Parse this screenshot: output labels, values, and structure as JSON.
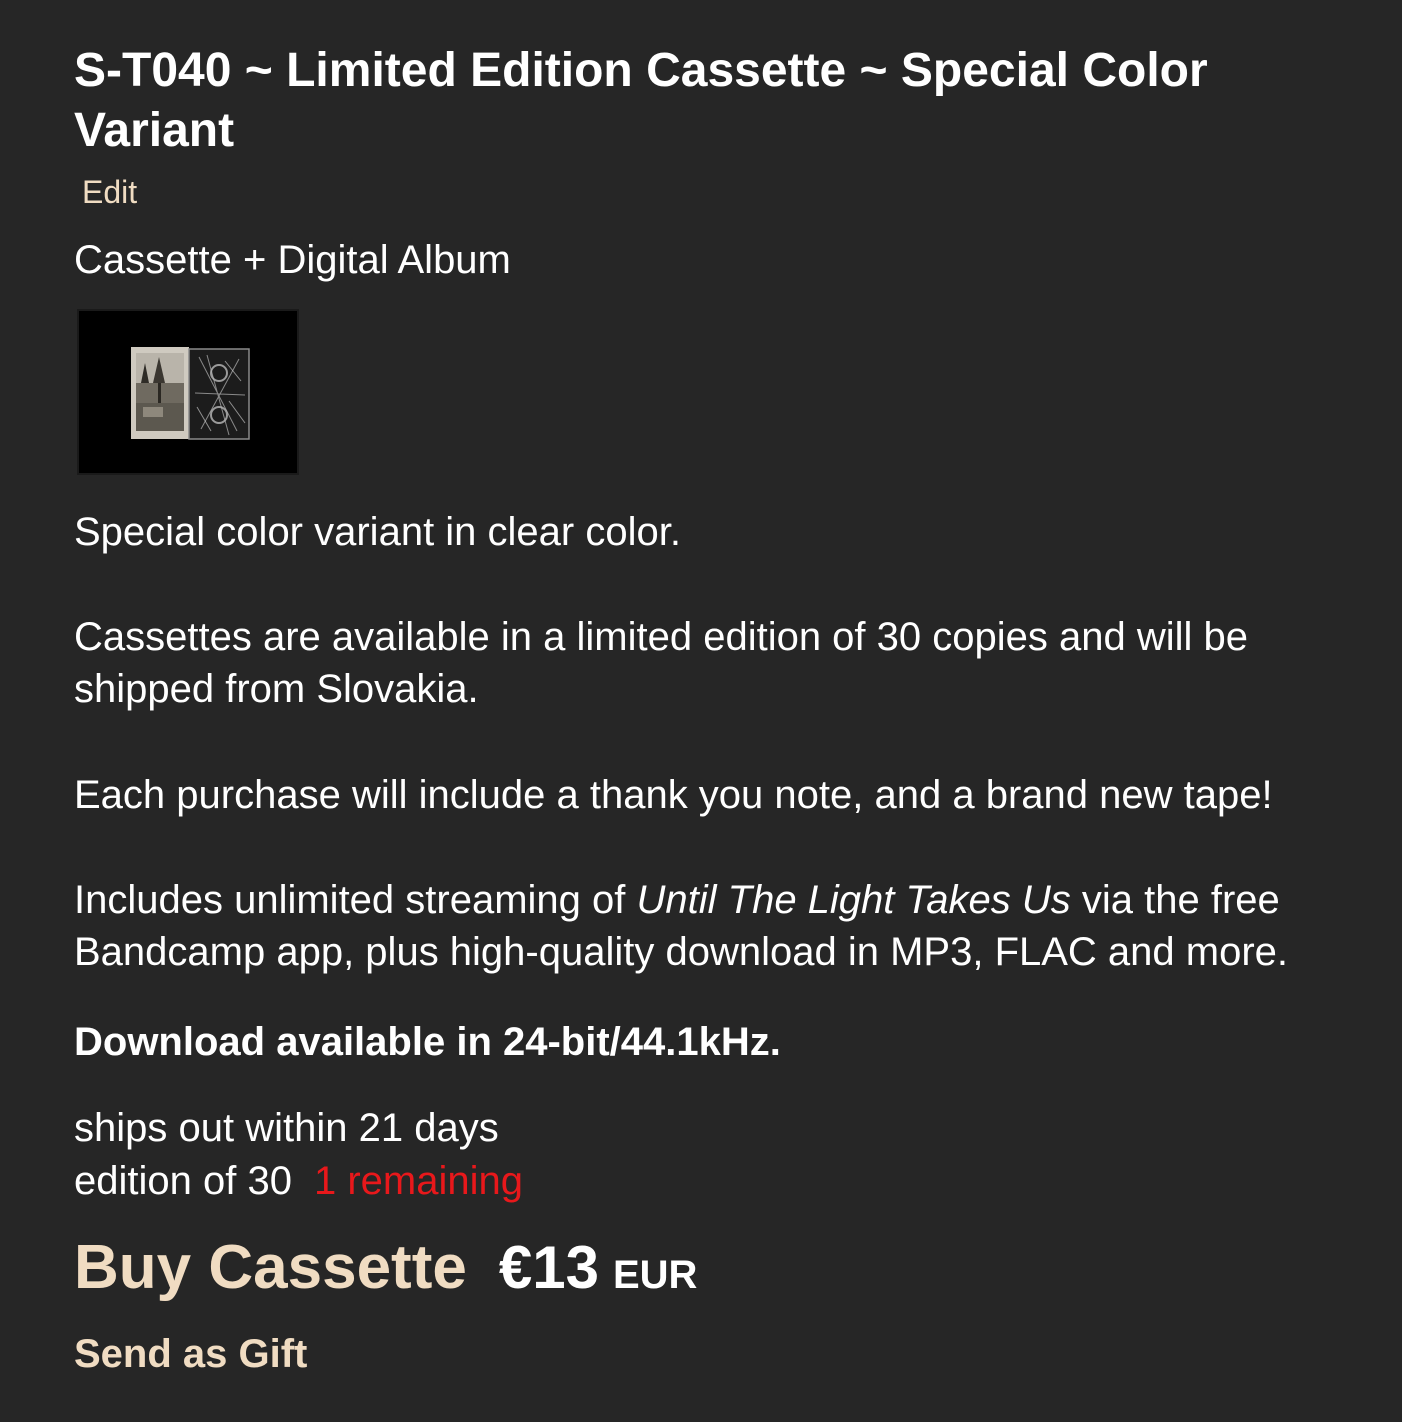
{
  "item": {
    "title": "S-T040 ~ Limited Edition Cassette ~ Special Color Variant",
    "edit_label": "Edit",
    "format": "Cassette + Digital Album"
  },
  "description": {
    "p1": "Special color variant in clear color.",
    "p2": "Cassettes are available in a limited edition of 30 copies and will be shipped from Slovakia.",
    "p3": "Each purchase will include a thank you note, and a brand new tape!",
    "p4_before": "Includes unlimited streaming of ",
    "p4_album": "Until The Light Takes Us",
    "p4_after": " via the free Bandcamp app, plus high-quality download in MP3, FLAC and more.",
    "hires": "Download available in 24-bit/44.1kHz."
  },
  "shipping": {
    "ships_out": "ships out within 21 days",
    "edition": "edition of 30",
    "remaining": "1 remaining"
  },
  "purchase": {
    "buy_label": "Buy Cassette",
    "price": "€13",
    "currency": "EUR",
    "gift_label": "Send as Gift"
  },
  "colors": {
    "background": "#262626",
    "link": "#f0dcc2",
    "remaining": "#e8181b"
  }
}
